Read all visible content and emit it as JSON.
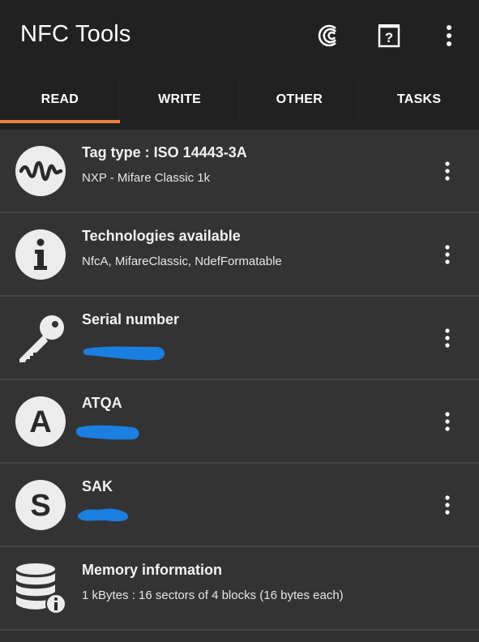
{
  "app": {
    "title": "NFC Tools",
    "actions": [
      {
        "icon": "coin-icon"
      },
      {
        "icon": "help-book-icon"
      },
      {
        "icon": "more-vert-icon"
      }
    ]
  },
  "tabs": [
    {
      "label": "READ",
      "selected": true
    },
    {
      "label": "WRITE",
      "selected": false
    },
    {
      "label": "OTHER",
      "selected": false
    },
    {
      "label": "TASKS",
      "selected": false
    }
  ],
  "rows": [
    {
      "icon": "waveform-icon",
      "title": "Tag type : ISO 14443-3A",
      "subtitle": "NXP - Mifare Classic 1k",
      "has_menu": true
    },
    {
      "icon": "info-icon",
      "title": "Technologies available",
      "subtitle": "NfcA, MifareClassic, NdefFormatable",
      "has_menu": true
    },
    {
      "icon": "key-icon",
      "title": "Serial number",
      "subtitle": "",
      "redacted": true,
      "has_menu": true
    },
    {
      "icon": "letter-a-icon",
      "title": "ATQA",
      "subtitle": "",
      "redacted": true,
      "has_menu": true
    },
    {
      "icon": "letter-s-icon",
      "title": "SAK",
      "subtitle": "",
      "redacted": true,
      "has_menu": true
    },
    {
      "icon": "database-info-icon",
      "title": "Memory information",
      "subtitle": "1 kBytes : 16 sectors of 4 blocks (16 bytes each)",
      "has_menu": false
    }
  ],
  "colors": {
    "appbar": "#212121",
    "background": "#333333",
    "tab_indicator": "#e9803f",
    "redaction": "#1a7fe0"
  }
}
